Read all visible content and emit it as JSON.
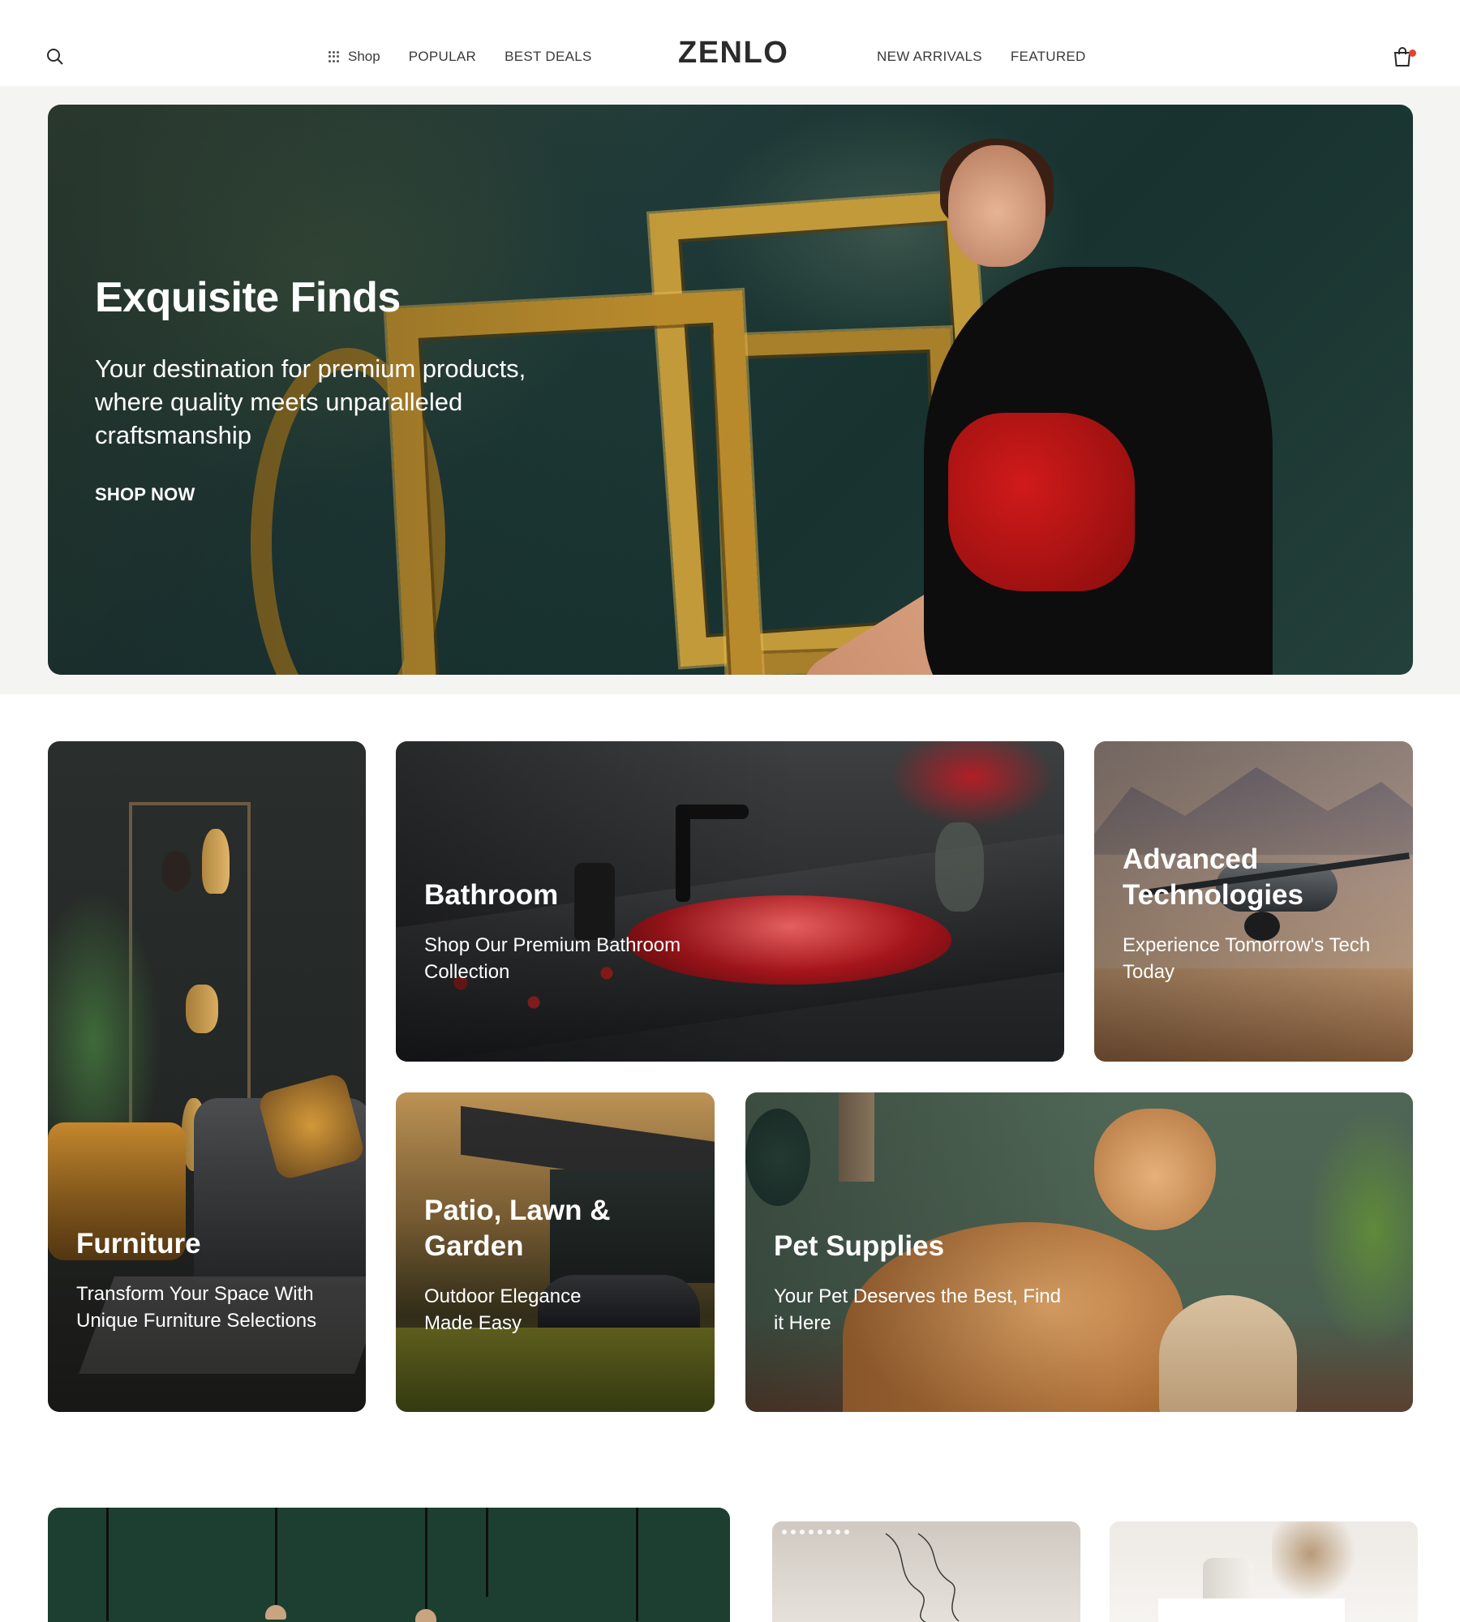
{
  "header": {
    "logo": "ZENLO",
    "nav_left": [
      {
        "label": "Shop"
      },
      {
        "label": "POPULAR"
      },
      {
        "label": "BEST DEALS"
      }
    ],
    "nav_right": [
      {
        "label": "NEW ARRIVALS"
      },
      {
        "label": "FEATURED"
      }
    ],
    "icons": {
      "search": "search-icon",
      "cart": "shopping-bag-icon",
      "shop": "grid-dots-icon"
    },
    "cart_badge_color": "#e0452f"
  },
  "hero": {
    "title": "Exquisite Finds",
    "subtitle": "Your destination for premium products, where quality meets unparalleled craftsmanship",
    "cta": "SHOP NOW"
  },
  "categories": [
    {
      "title": "Furniture",
      "subtitle": "Transform Your Space With Unique Furniture Selections"
    },
    {
      "title": "Bathroom",
      "subtitle": "Shop Our Premium Bathroom Collection"
    },
    {
      "title": "Advanced Technologies",
      "subtitle": "Experience Tomorrow's Tech Today"
    },
    {
      "title": "Patio, Lawn & Garden",
      "subtitle": "Outdoor Elegance Made Easy"
    },
    {
      "title": "Pet Supplies",
      "subtitle": "Your Pet Deserves the Best, Find it Here"
    }
  ],
  "colors": {
    "text": "#2a2a2a",
    "hero_bg": "#f4f4f2",
    "accent": "#e0452f"
  }
}
